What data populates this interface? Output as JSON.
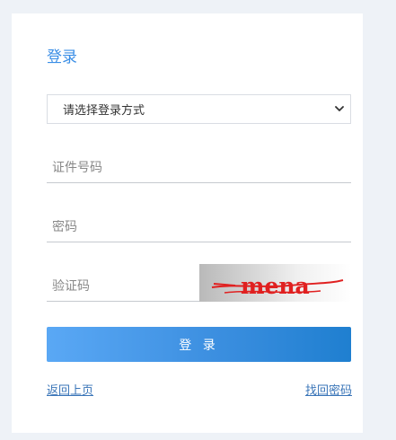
{
  "login": {
    "title": "登录",
    "method_select": {
      "value": "请选择登录方式"
    },
    "id_field": {
      "placeholder": "证件号码",
      "value": ""
    },
    "password_field": {
      "placeholder": "密码",
      "value": ""
    },
    "captcha_field": {
      "placeholder": "验证码",
      "value": ""
    },
    "captcha_image": {
      "text": "mena"
    },
    "submit_label": "登 录",
    "back_link": "返回上页",
    "find_password_link": "找回密码"
  },
  "colors": {
    "accent": "#3a8ee6",
    "button_start": "#5aa8f5",
    "button_end": "#1f7fd0",
    "link": "#3a75b8",
    "captcha_text": "#e02020"
  },
  "icons": {
    "select_arrow": "chevron-down-icon"
  }
}
